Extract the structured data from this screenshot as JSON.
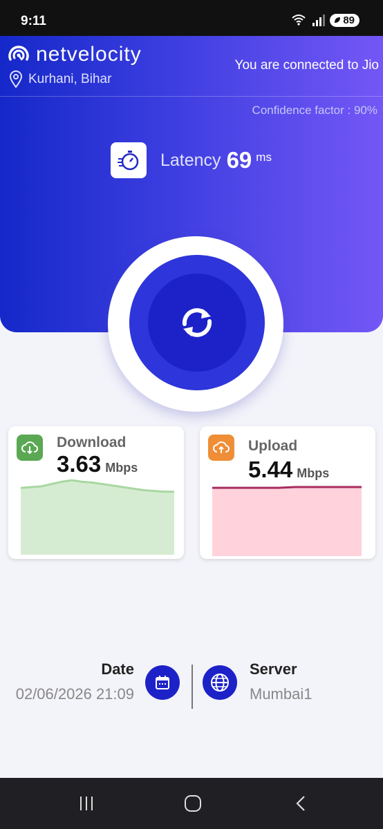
{
  "status_bar": {
    "time": "9:11",
    "battery": "89"
  },
  "header": {
    "app_name": "netvelocity",
    "location": "Kurhani, Bihar",
    "connection_status": "You are connected to Jio",
    "confidence": "Confidence factor : 90%",
    "latency_label": "Latency",
    "latency_value": "69",
    "latency_unit": "ms"
  },
  "download": {
    "title": "Download",
    "value": "3.63",
    "unit": "Mbps",
    "color": "#5aa853",
    "fill_color": "#d6ecd2",
    "line_color": "#a8d7a0",
    "trend": [
      0.88,
      0.89,
      0.9,
      0.93,
      0.96,
      0.98,
      0.96,
      0.95,
      0.93,
      0.91,
      0.89,
      0.87,
      0.85,
      0.84,
      0.83,
      0.83
    ]
  },
  "upload": {
    "title": "Upload",
    "value": "5.44",
    "unit": "Mbps",
    "color": "#ef8e36",
    "fill_color": "#ffd2dc",
    "line_color": "#a62c5e",
    "trend": [
      0.97,
      0.97,
      0.97,
      0.97,
      0.97,
      0.98,
      0.98,
      0.98,
      0.98,
      0.98
    ]
  },
  "info": {
    "date_label": "Date",
    "date_value": "02/06/2026 21:09",
    "server_label": "Server",
    "server_value": "Mumbai1"
  },
  "colors": {
    "accent": "#1d22c8",
    "gradient_start": "#1528c9",
    "gradient_end": "#7457f6"
  }
}
